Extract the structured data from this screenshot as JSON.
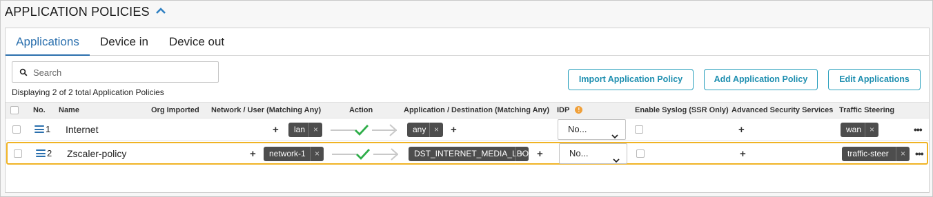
{
  "section": {
    "title": "APPLICATION POLICIES",
    "toggle_icon": "chevron-up-icon"
  },
  "tabs": [
    {
      "label": "Applications",
      "active": true
    },
    {
      "label": "Device in",
      "active": false
    },
    {
      "label": "Device out",
      "active": false
    }
  ],
  "search": {
    "placeholder": "Search",
    "value": ""
  },
  "status_text": "Displaying 2 of 2 total Application Policies",
  "buttons": {
    "import": "Import Application Policy",
    "add": "Add Application Policy",
    "edit": "Edit Applications"
  },
  "columns": {
    "no": "No.",
    "name": "Name",
    "org_imported": "Org Imported",
    "network": "Network / User (Matching Any)",
    "action": "Action",
    "app_dest": "Application / Destination (Matching Any)",
    "idp": "IDP",
    "syslog": "Enable Syslog (SSR Only)",
    "advanced": "Advanced Security Services",
    "steering": "Traffic Steering"
  },
  "add_symbol": "+",
  "remove_symbol": "×",
  "more_symbol": "•••",
  "colors": {
    "accent": "#2a6fad",
    "button": "#1f8fb0",
    "allow": "#2fae4a",
    "highlight": "#f0b323",
    "chip": "#4d4d4d"
  },
  "rows": [
    {
      "no": "1",
      "name": "Internet",
      "network": "lan",
      "action": "allow",
      "app_dest": "any",
      "idp": "No...",
      "syslog": false,
      "steering": "wan"
    },
    {
      "no": "2",
      "name": "Zscaler-policy",
      "network": "network-1",
      "action": "allow",
      "app_dest": "DST_INTERNET_MEDIA_LBO",
      "idp": "No...",
      "syslog": false,
      "steering": "traffic-steer"
    }
  ]
}
